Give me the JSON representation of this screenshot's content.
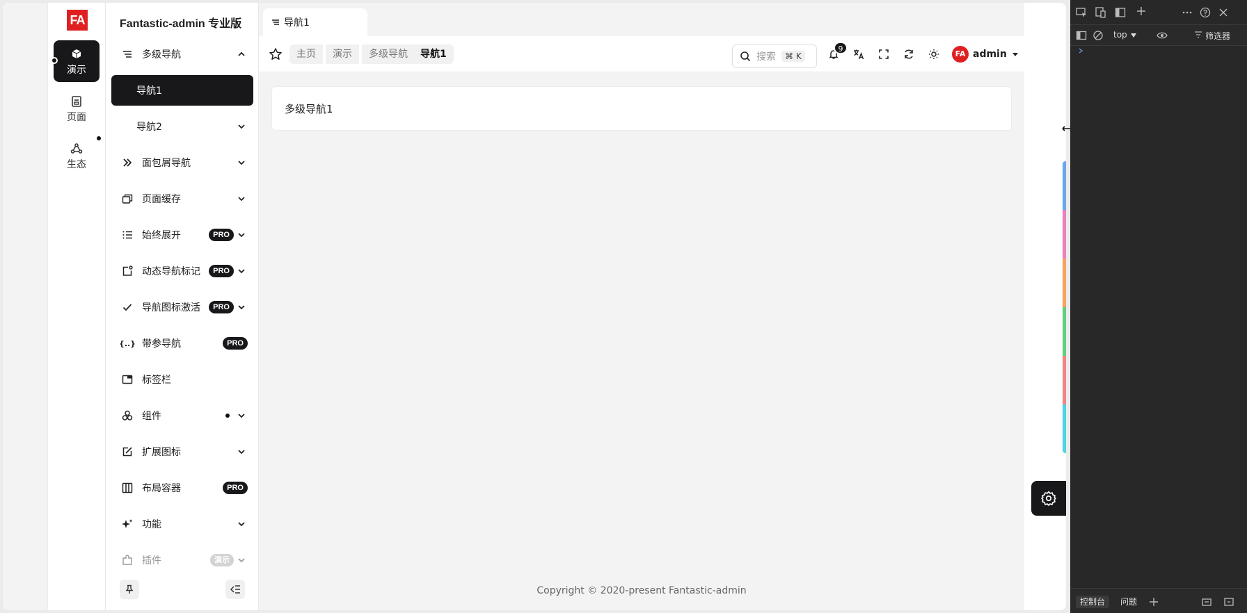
{
  "brand": {
    "logo_text": "FA",
    "title": "Fantastic-admin 专业版"
  },
  "main_nav": [
    {
      "label": "演示",
      "icon": "cube-icon",
      "active": true
    },
    {
      "label": "页面",
      "icon": "page-icon",
      "active": false
    },
    {
      "label": "生态",
      "icon": "ecosystem-icon",
      "active": false
    }
  ],
  "sub_menu": {
    "items": [
      {
        "label": "多级导航",
        "icon": "list-icon",
        "expanded": true
      },
      {
        "label": "导航1",
        "active": true
      },
      {
        "label": "导航2"
      },
      {
        "label": "面包屑导航",
        "icon": "chevrons-right-icon"
      },
      {
        "label": "页面缓存",
        "icon": "layers-icon"
      },
      {
        "label": "始终展开",
        "icon": "list-bullets-icon",
        "badge": "PRO"
      },
      {
        "label": "动态导航标记",
        "icon": "badge-icon",
        "badge": "PRO"
      },
      {
        "label": "导航图标激活",
        "icon": "check-icon",
        "badge": "PRO"
      },
      {
        "label": "带参导航",
        "icon": "braces-icon",
        "badge": "PRO"
      },
      {
        "label": "标签栏",
        "icon": "window-icon"
      },
      {
        "label": "组件",
        "icon": "components-icon"
      },
      {
        "label": "扩展图标",
        "icon": "edit-icon"
      },
      {
        "label": "布局容器",
        "icon": "columns-icon",
        "badge": "PRO"
      },
      {
        "label": "功能",
        "icon": "sparkles-icon"
      },
      {
        "label": "插件",
        "icon": "plugin-icon",
        "badge": "演示"
      }
    ],
    "braces_glyph": "{..}"
  },
  "tabbar": {
    "active_tab": "导航1"
  },
  "breadcrumb": [
    "主页",
    "演示",
    "多级导航",
    "导航1"
  ],
  "search": {
    "placeholder": "搜索",
    "shortcut": "⌘ K"
  },
  "notifications": {
    "count": "9"
  },
  "user": {
    "name": "admin"
  },
  "content": {
    "card_title": "多级导航1"
  },
  "footer": {
    "copyright": "Copyright © 2020-present  Fantastic-admin"
  },
  "colors": {
    "accent_dark": "#18181b",
    "brand_red": "#e02020",
    "strip": [
      "#6aa6ee",
      "#ec7fbd",
      "#f5a25d",
      "#5fcf80",
      "#f08585",
      "#4fd3e6"
    ]
  },
  "devtools": {
    "context": "top",
    "filter": "筛选器",
    "tab_console": "控制台",
    "tab_issues": "问题"
  }
}
